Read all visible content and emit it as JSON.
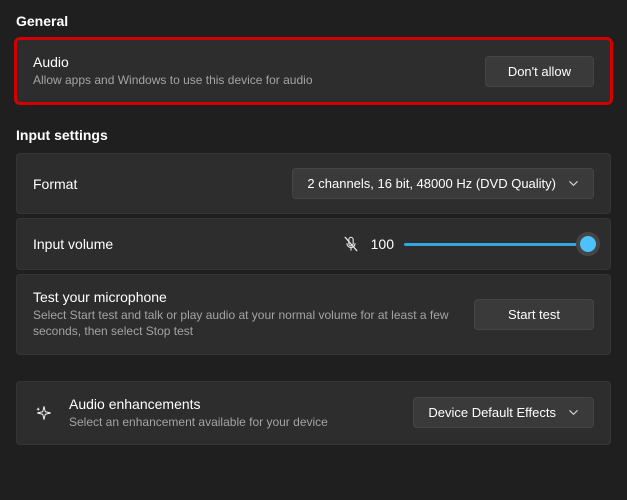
{
  "general": {
    "header": "General",
    "audio": {
      "title": "Audio",
      "subtitle": "Allow apps and Windows to use this device for audio",
      "button": "Don't allow"
    }
  },
  "input": {
    "header": "Input settings",
    "format": {
      "label": "Format",
      "value": "2 channels, 16 bit, 48000 Hz (DVD Quality)"
    },
    "volume": {
      "label": "Input volume",
      "value": "100"
    },
    "mic_test": {
      "title": "Test your microphone",
      "subtitle": "Select Start test and talk or play audio at your normal volume for at least a few seconds, then select Stop test",
      "button": "Start test"
    },
    "enhancements": {
      "title": "Audio enhancements",
      "subtitle": "Select an enhancement available for your device",
      "value": "Device Default Effects"
    }
  }
}
